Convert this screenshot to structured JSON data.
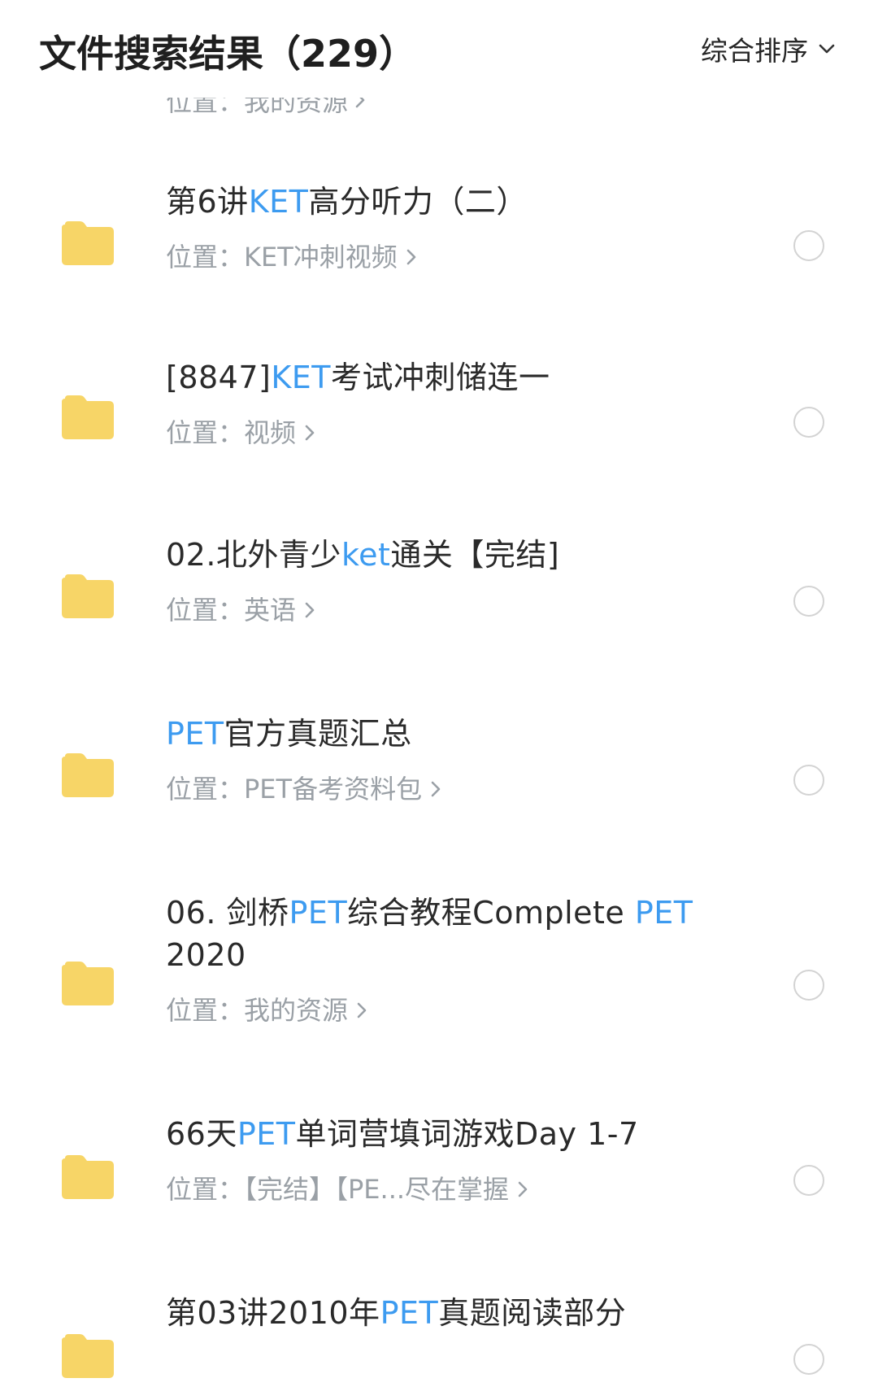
{
  "header": {
    "title": "文件搜索结果（229）",
    "sort_label": "综合排序"
  },
  "colors": {
    "highlight": "#3d9bf0",
    "folder": "#f7d567",
    "text": "#2a2a2a",
    "secondary": "#9aa0a6"
  },
  "clipped_item": {
    "location": "位置：我的资源"
  },
  "items": [
    {
      "segments": [
        {
          "t": "第6讲",
          "h": false
        },
        {
          "t": "KET",
          "h": true
        },
        {
          "t": "高分听力（二）",
          "h": false
        }
      ],
      "location": "位置：KET冲刺视频"
    },
    {
      "segments": [
        {
          "t": "[8847]",
          "h": false
        },
        {
          "t": "KET",
          "h": true
        },
        {
          "t": "考试冲刺储连一",
          "h": false
        }
      ],
      "location": "位置：视频"
    },
    {
      "segments": [
        {
          "t": "02.北外青少",
          "h": false
        },
        {
          "t": "ket",
          "h": true
        },
        {
          "t": "通关【完结]",
          "h": false
        }
      ],
      "location": "位置：英语"
    },
    {
      "segments": [
        {
          "t": "PET",
          "h": true
        },
        {
          "t": "官方真题汇总",
          "h": false
        }
      ],
      "location": "位置：PET备考资料包"
    },
    {
      "segments": [
        {
          "t": "06. 剑桥",
          "h": false
        },
        {
          "t": "PET",
          "h": true
        },
        {
          "t": "综合教程Complete ",
          "h": false
        },
        {
          "t": "PET",
          "h": true
        },
        {
          "t": " 2020",
          "h": false
        }
      ],
      "location": "位置：我的资源"
    },
    {
      "segments": [
        {
          "t": "66天",
          "h": false
        },
        {
          "t": "PET",
          "h": true
        },
        {
          "t": "单词营填词游戏Day 1-7",
          "h": false
        }
      ],
      "location": "位置：【完结】【PE...尽在掌握"
    },
    {
      "segments": [
        {
          "t": "第03讲2010年",
          "h": false
        },
        {
          "t": "PET",
          "h": true
        },
        {
          "t": "真题阅读部分",
          "h": false
        }
      ],
      "location": ""
    }
  ]
}
